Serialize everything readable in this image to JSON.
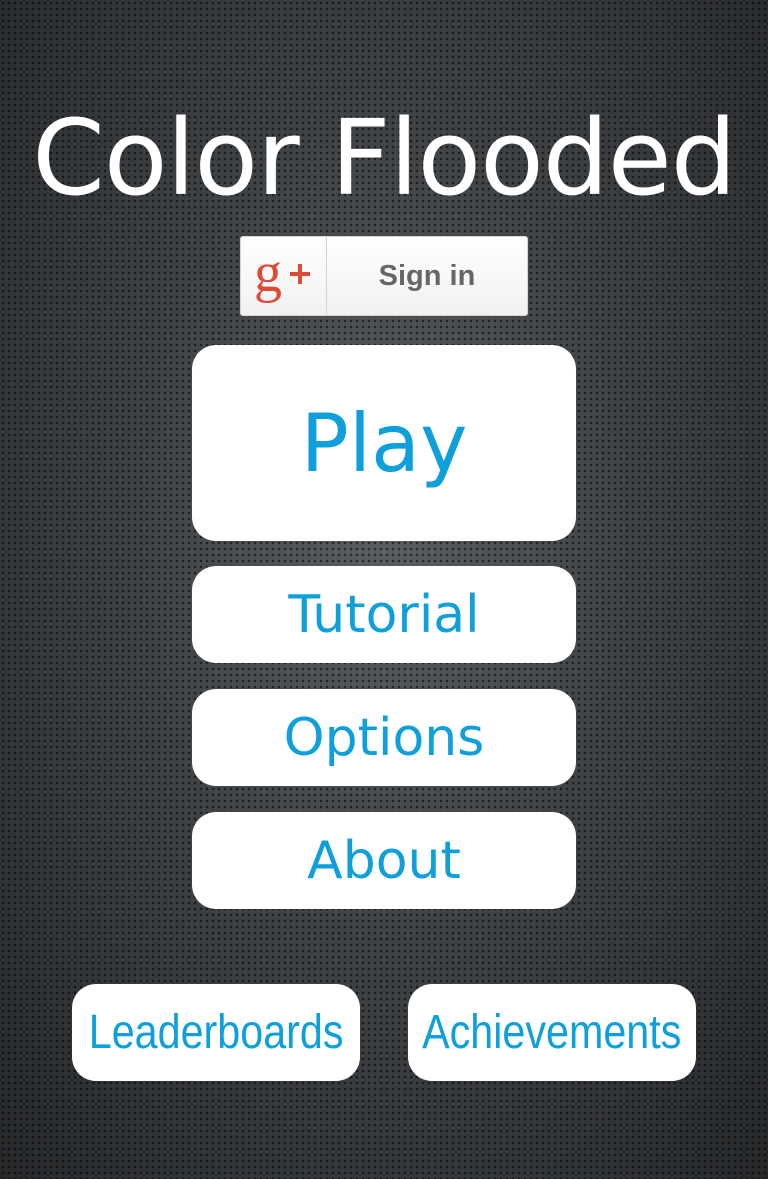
{
  "app": {
    "title": "Color Flooded"
  },
  "signin": {
    "label": "Sign in",
    "icon": "google-plus-icon",
    "icon_color": "#dd4b39"
  },
  "menu": {
    "play": "Play",
    "tutorial": "Tutorial",
    "options": "Options",
    "about": "About"
  },
  "footer": {
    "leaderboards": "Leaderboards",
    "achievements": "Achievements"
  },
  "colors": {
    "accent": "#0fa0dc",
    "button_bg": "#ffffff",
    "title": "#ffffff"
  }
}
